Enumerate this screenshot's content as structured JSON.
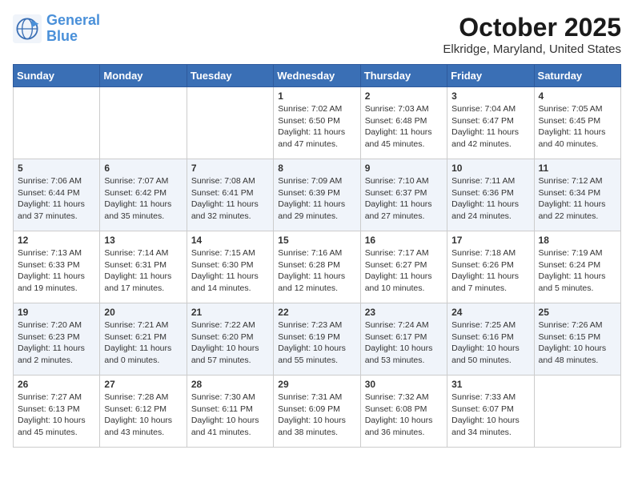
{
  "logo": {
    "line1": "General",
    "line2": "Blue"
  },
  "title": "October 2025",
  "location": "Elkridge, Maryland, United States",
  "weekdays": [
    "Sunday",
    "Monday",
    "Tuesday",
    "Wednesday",
    "Thursday",
    "Friday",
    "Saturday"
  ],
  "weeks": [
    [
      {
        "day": "",
        "info": ""
      },
      {
        "day": "",
        "info": ""
      },
      {
        "day": "",
        "info": ""
      },
      {
        "day": "1",
        "info": "Sunrise: 7:02 AM\nSunset: 6:50 PM\nDaylight: 11 hours\nand 47 minutes."
      },
      {
        "day": "2",
        "info": "Sunrise: 7:03 AM\nSunset: 6:48 PM\nDaylight: 11 hours\nand 45 minutes."
      },
      {
        "day": "3",
        "info": "Sunrise: 7:04 AM\nSunset: 6:47 PM\nDaylight: 11 hours\nand 42 minutes."
      },
      {
        "day": "4",
        "info": "Sunrise: 7:05 AM\nSunset: 6:45 PM\nDaylight: 11 hours\nand 40 minutes."
      }
    ],
    [
      {
        "day": "5",
        "info": "Sunrise: 7:06 AM\nSunset: 6:44 PM\nDaylight: 11 hours\nand 37 minutes."
      },
      {
        "day": "6",
        "info": "Sunrise: 7:07 AM\nSunset: 6:42 PM\nDaylight: 11 hours\nand 35 minutes."
      },
      {
        "day": "7",
        "info": "Sunrise: 7:08 AM\nSunset: 6:41 PM\nDaylight: 11 hours\nand 32 minutes."
      },
      {
        "day": "8",
        "info": "Sunrise: 7:09 AM\nSunset: 6:39 PM\nDaylight: 11 hours\nand 29 minutes."
      },
      {
        "day": "9",
        "info": "Sunrise: 7:10 AM\nSunset: 6:37 PM\nDaylight: 11 hours\nand 27 minutes."
      },
      {
        "day": "10",
        "info": "Sunrise: 7:11 AM\nSunset: 6:36 PM\nDaylight: 11 hours\nand 24 minutes."
      },
      {
        "day": "11",
        "info": "Sunrise: 7:12 AM\nSunset: 6:34 PM\nDaylight: 11 hours\nand 22 minutes."
      }
    ],
    [
      {
        "day": "12",
        "info": "Sunrise: 7:13 AM\nSunset: 6:33 PM\nDaylight: 11 hours\nand 19 minutes."
      },
      {
        "day": "13",
        "info": "Sunrise: 7:14 AM\nSunset: 6:31 PM\nDaylight: 11 hours\nand 17 minutes."
      },
      {
        "day": "14",
        "info": "Sunrise: 7:15 AM\nSunset: 6:30 PM\nDaylight: 11 hours\nand 14 minutes."
      },
      {
        "day": "15",
        "info": "Sunrise: 7:16 AM\nSunset: 6:28 PM\nDaylight: 11 hours\nand 12 minutes."
      },
      {
        "day": "16",
        "info": "Sunrise: 7:17 AM\nSunset: 6:27 PM\nDaylight: 11 hours\nand 10 minutes."
      },
      {
        "day": "17",
        "info": "Sunrise: 7:18 AM\nSunset: 6:26 PM\nDaylight: 11 hours\nand 7 minutes."
      },
      {
        "day": "18",
        "info": "Sunrise: 7:19 AM\nSunset: 6:24 PM\nDaylight: 11 hours\nand 5 minutes."
      }
    ],
    [
      {
        "day": "19",
        "info": "Sunrise: 7:20 AM\nSunset: 6:23 PM\nDaylight: 11 hours\nand 2 minutes."
      },
      {
        "day": "20",
        "info": "Sunrise: 7:21 AM\nSunset: 6:21 PM\nDaylight: 11 hours\nand 0 minutes."
      },
      {
        "day": "21",
        "info": "Sunrise: 7:22 AM\nSunset: 6:20 PM\nDaylight: 10 hours\nand 57 minutes."
      },
      {
        "day": "22",
        "info": "Sunrise: 7:23 AM\nSunset: 6:19 PM\nDaylight: 10 hours\nand 55 minutes."
      },
      {
        "day": "23",
        "info": "Sunrise: 7:24 AM\nSunset: 6:17 PM\nDaylight: 10 hours\nand 53 minutes."
      },
      {
        "day": "24",
        "info": "Sunrise: 7:25 AM\nSunset: 6:16 PM\nDaylight: 10 hours\nand 50 minutes."
      },
      {
        "day": "25",
        "info": "Sunrise: 7:26 AM\nSunset: 6:15 PM\nDaylight: 10 hours\nand 48 minutes."
      }
    ],
    [
      {
        "day": "26",
        "info": "Sunrise: 7:27 AM\nSunset: 6:13 PM\nDaylight: 10 hours\nand 45 minutes."
      },
      {
        "day": "27",
        "info": "Sunrise: 7:28 AM\nSunset: 6:12 PM\nDaylight: 10 hours\nand 43 minutes."
      },
      {
        "day": "28",
        "info": "Sunrise: 7:30 AM\nSunset: 6:11 PM\nDaylight: 10 hours\nand 41 minutes."
      },
      {
        "day": "29",
        "info": "Sunrise: 7:31 AM\nSunset: 6:09 PM\nDaylight: 10 hours\nand 38 minutes."
      },
      {
        "day": "30",
        "info": "Sunrise: 7:32 AM\nSunset: 6:08 PM\nDaylight: 10 hours\nand 36 minutes."
      },
      {
        "day": "31",
        "info": "Sunrise: 7:33 AM\nSunset: 6:07 PM\nDaylight: 10 hours\nand 34 minutes."
      },
      {
        "day": "",
        "info": ""
      }
    ]
  ]
}
